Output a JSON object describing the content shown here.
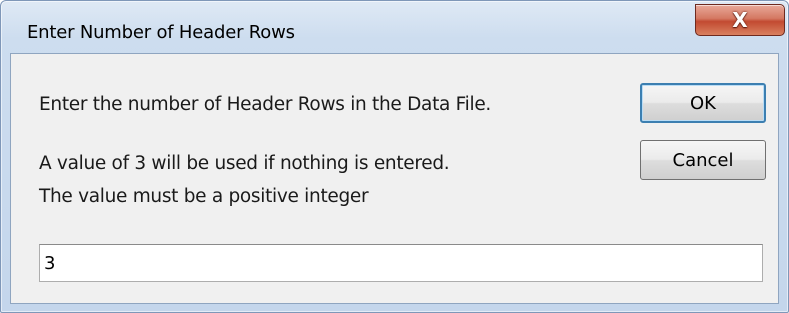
{
  "window": {
    "title": "Enter Number of Header Rows",
    "close_symbol": "X",
    "close_icon": "close-icon"
  },
  "dialog": {
    "prompt": "Enter the number of Header Rows in the Data File.",
    "default_note": "A value of 3 will be used if nothing is entered.",
    "constraint_note": "The value must be a positive integer",
    "input_value": "3"
  },
  "buttons": {
    "ok_label": "OK",
    "cancel_label": "Cancel"
  },
  "colors": {
    "frame": "#c4d6ec",
    "client": "#f0f0f0",
    "close_button": "#c24a31",
    "default_button_border": "#3c7fb1"
  }
}
